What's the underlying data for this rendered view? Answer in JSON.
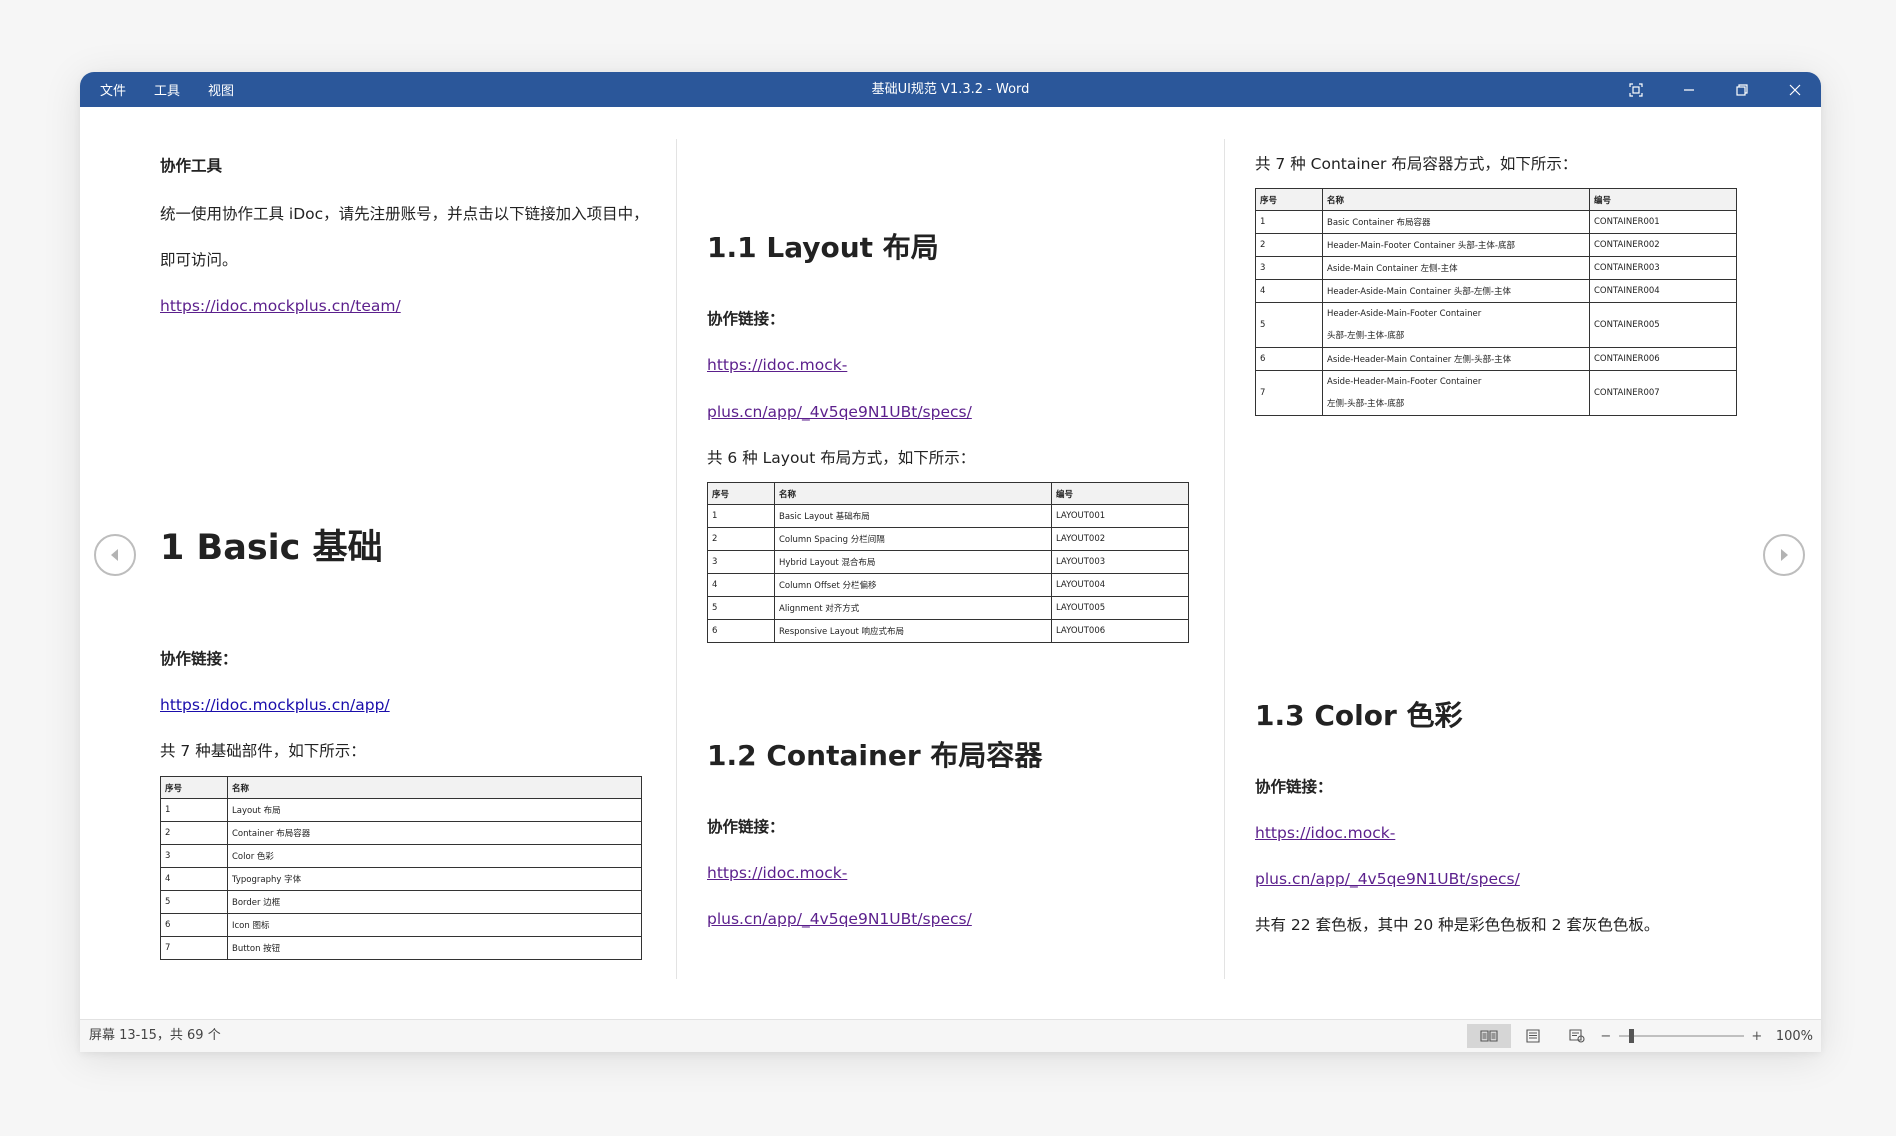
{
  "window": {
    "title": "基础UI规范 V1.3.2  -  Word",
    "menu": [
      "文件",
      "工具",
      "视图"
    ]
  },
  "page1": {
    "tool_heading": "协作工具",
    "tool_desc_line1": "统一使用协作工具 iDoc，请先注册账号，并点击以下链接加入项目中，",
    "tool_desc_line2": "即可访问。",
    "team_link": "https://idoc.mockplus.cn/team/",
    "section_title": "1 Basic  基础",
    "collab_label": "协作链接：",
    "collab_link": "https://idoc.mockplus.cn/app/",
    "table_intro": "共 7  种基础部件，如下所示：",
    "table": {
      "headers": [
        "序号",
        "名称"
      ],
      "rows": [
        [
          "1",
          "Layout  布局"
        ],
        [
          "2",
          "Container  布局容器"
        ],
        [
          "3",
          "Color  色彩"
        ],
        [
          "4",
          "Typography  字体"
        ],
        [
          "5",
          "Border  边框"
        ],
        [
          "6",
          "Icon  图标"
        ],
        [
          "7",
          "Button  按钮"
        ]
      ]
    }
  },
  "page2": {
    "section_title": "1.1 Layout  布局",
    "collab_label": "协作链接：",
    "link_line1": "https://idoc.mock-",
    "link_line2": "plus.cn/app/_4v5qe9N1UBt/specs/",
    "table_intro": "共 6 种 Layout 布局方式，如下所示：",
    "table": {
      "headers": [
        "序号",
        "名称",
        "编号"
      ],
      "rows": [
        [
          "1",
          "Basic Layout 基础布局",
          "LAYOUT001"
        ],
        [
          "2",
          "Column Spacing 分栏间隔",
          "LAYOUT002"
        ],
        [
          "3",
          "Hybrid Layout 混合布局",
          "LAYOUT003"
        ],
        [
          "4",
          "Column Offset 分栏偏移",
          "LAYOUT004"
        ],
        [
          "5",
          "Alignment 对齐方式",
          "LAYOUT005"
        ],
        [
          "6",
          "Responsive Layout 响应式布局",
          "LAYOUT006"
        ]
      ]
    },
    "section2_title": "1.2 Container  布局容器",
    "collab2_label": "协作链接：",
    "link2_line1": "https://idoc.mock-",
    "link2_line2": "plus.cn/app/_4v5qe9N1UBt/specs/"
  },
  "page3": {
    "table_intro": "共 7 种 Container 布局容器方式，如下所示：",
    "table": {
      "headers": [
        "序号",
        "名称",
        "编号"
      ],
      "rows": [
        [
          "1",
          "Basic Container 布局容器",
          "",
          "CONTAINER001"
        ],
        [
          "2",
          "Header-Main-Footer Container 头部-主体-底部",
          "",
          "CONTAINER002"
        ],
        [
          "3",
          "Aside-Main Container 左侧-主体",
          "",
          "CONTAINER003"
        ],
        [
          "4",
          "Header-Aside-Main Container 头部-左侧-主体",
          "",
          "CONTAINER004"
        ],
        [
          "5",
          "Header-Aside-Main-Footer Container",
          "头部-左侧-主体-底部",
          "CONTAINER005"
        ],
        [
          "6",
          "Aside-Header-Main Container 左侧-头部-主体",
          "",
          "CONTAINER006"
        ],
        [
          "7",
          "Aside-Header-Main-Footer Container",
          "左侧-头部-主体-底部",
          "CONTAINER007"
        ]
      ]
    },
    "section_title": "1.3 Color  色彩",
    "collab_label": "协作链接：",
    "link_line1": "https://idoc.mock-",
    "link_line2": "plus.cn/app/_4v5qe9N1UBt/specs/",
    "summary": "共有 22 套色板，其中 20 种是彩色色板和 2 套灰色色板。"
  },
  "status": {
    "page_info": "屏幕 13-15，共 69 个",
    "zoom": "100%"
  },
  "icons": {
    "prev": "chevron-left-icon",
    "next": "chevron-right-icon",
    "focus": "focus-mode-icon",
    "minimize": "minimize-icon",
    "restore": "restore-icon",
    "close": "close-icon",
    "read_mode": "read-mode-icon",
    "print_layout": "print-layout-icon",
    "web_layout": "web-layout-icon"
  },
  "colors": {
    "titlebar": "#2b579a",
    "link_visited": "#5b1f8c",
    "link": "#1a0dab"
  }
}
